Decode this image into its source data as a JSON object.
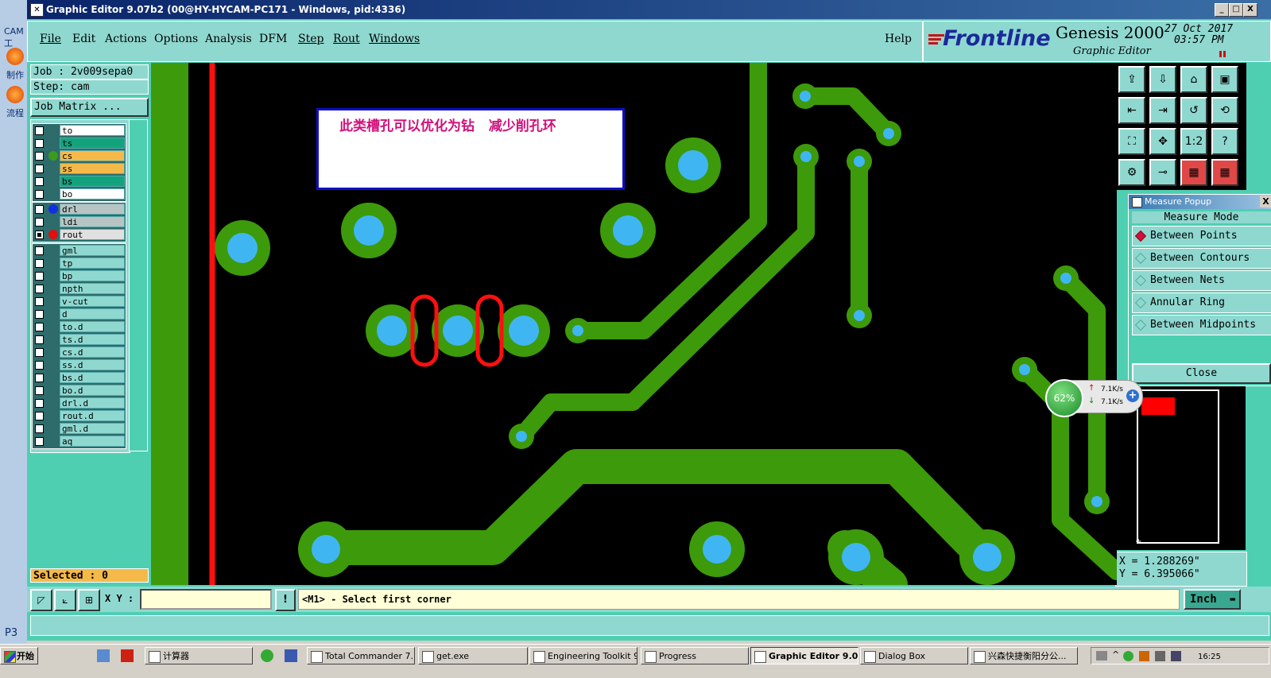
{
  "window": {
    "title": "Graphic Editor 9.07b2 (00@HY-HYCAM-PC171 - Windows, pid:4336)",
    "min_label": "_",
    "max_label": "□",
    "close_label": "X"
  },
  "desktop": {
    "labels": [
      "CAM工",
      "制作",
      "流程",
      "P3"
    ]
  },
  "menu": {
    "items": [
      "File",
      "Edit",
      "Actions",
      "Options",
      "Analysis",
      "DFM",
      "Step",
      "Rout",
      "Windows"
    ],
    "help": "Help"
  },
  "brand": {
    "logo": "Frontline",
    "product": "Genesis 2000",
    "subtitle": "Graphic Editor",
    "date": "27 Oct 2017",
    "time": "03:57 PM"
  },
  "left": {
    "job": "Job : 2v009sepa0",
    "step": "Step: cam",
    "job_matrix": "Job Matrix ...",
    "selected": "Selected : 0",
    "board_layers": [
      {
        "name": "to",
        "color": "#ffffff"
      },
      {
        "name": "ts",
        "color": "#13a37c"
      },
      {
        "name": "cs",
        "color": "#f5b94a",
        "dot": "#3c9a1e"
      },
      {
        "name": "ss",
        "color": "#f5b94a"
      },
      {
        "name": "bs",
        "color": "#13a37c"
      },
      {
        "name": "bo",
        "color": "#ffffff"
      }
    ],
    "drill_layers": [
      {
        "name": "drl",
        "color": "#b8c4c4",
        "dot": "#1030e0"
      },
      {
        "name": "ldi",
        "color": "#b8c4c4"
      },
      {
        "name": "rout",
        "color": "#e0e0e0",
        "dot": "#e01010",
        "checked": true
      }
    ],
    "misc_layers": [
      "gml",
      "tp",
      "bp",
      "npth",
      "v-cut",
      "d",
      "to.d",
      "ts.d",
      "cs.d",
      "ss.d",
      "bs.d",
      "bo.d",
      "drl.d",
      "rout.d",
      "gml.d",
      "aq"
    ]
  },
  "annotation": {
    "text": "此类槽孔可以优化为钻   减少削孔环"
  },
  "measure_popup": {
    "title": "Measure Popup",
    "close_x": "X",
    "mode_label": "Measure Mode",
    "options": [
      "Between Points",
      "Between Contours",
      "Between Nets",
      "Annular Ring",
      "Between Midpoints"
    ],
    "selected_index": 0,
    "close_button": "Close"
  },
  "net_widget": {
    "percent": "62%",
    "up": "7.1K/s",
    "down": "7.1K/s",
    "plus": "+"
  },
  "coords": {
    "x": "X  = 1.288269\"",
    "y": "Y  = 6.395066\""
  },
  "tools": {
    "ratio_label": "1:2",
    "help_label": "?"
  },
  "status": {
    "xy_label": "X Y :",
    "xy_value": "",
    "info_icon": "!",
    "prompt": "<M1> - Select first corner",
    "units": "Inch"
  },
  "taskbar": {
    "start": "开始",
    "tasks": [
      "计算器",
      "Total Commander 7....",
      "get.exe",
      "Engineering Toolkit 9...",
      "Progress",
      "Graphic Editor 9.0...",
      "Dialog Box",
      "兴森快捷衡阳分公..."
    ],
    "active_index": 5,
    "clock": "16:25"
  },
  "colors": {
    "copper": "#3d9a0a",
    "pad_hole": "#3fb6f2",
    "rout": "#ff1010",
    "panel": "#4fcfb2",
    "panel_light": "#8fd8d0",
    "annotation_text": "#d0107a"
  }
}
